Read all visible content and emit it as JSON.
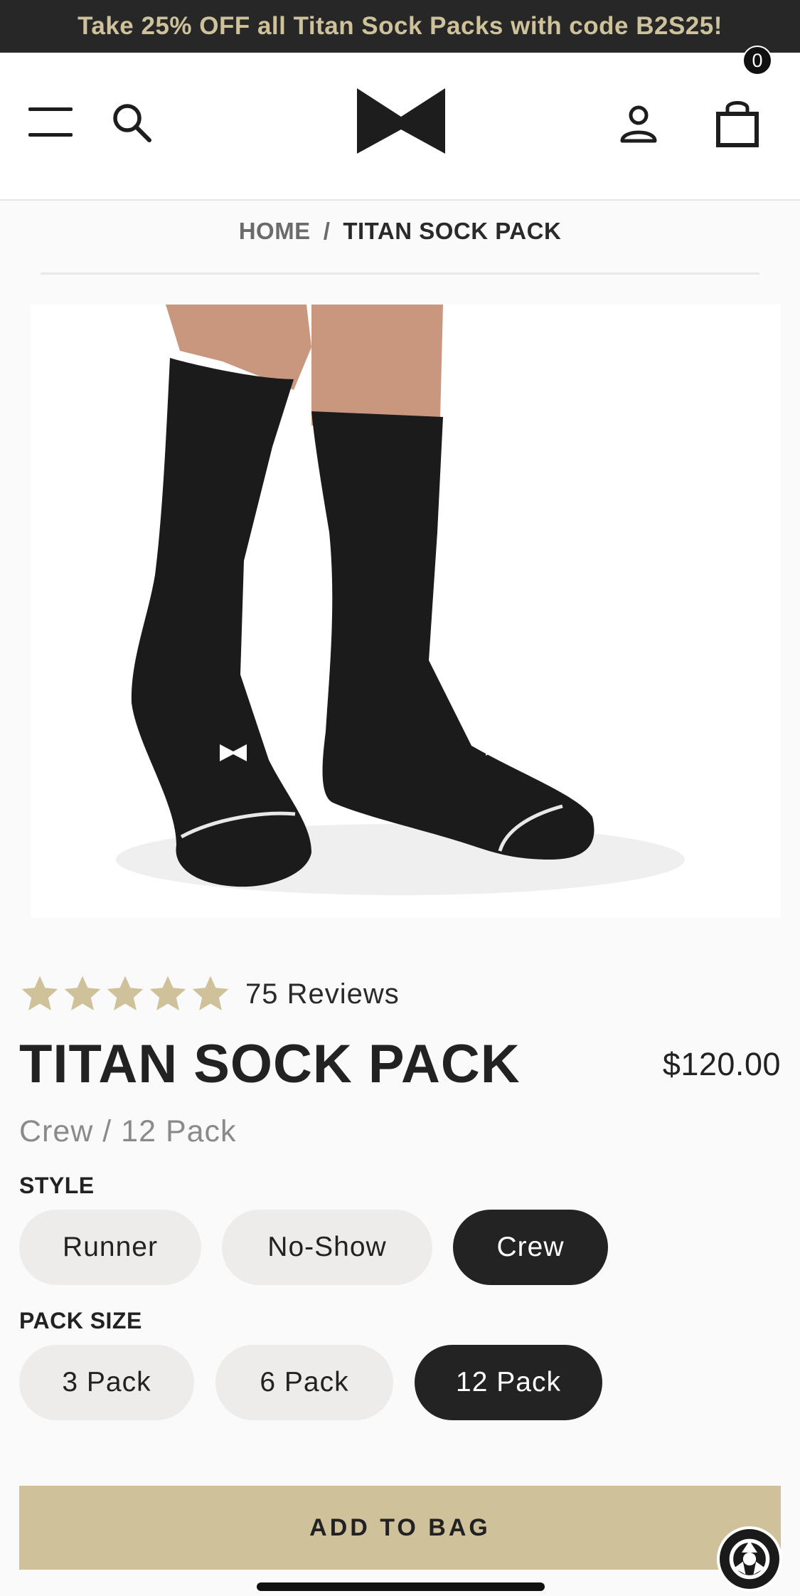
{
  "promo_banner": {
    "text": "Take 25% OFF all Titan Sock Packs with code B2S25!"
  },
  "header": {
    "menu_icon": "hamburger-menu-icon",
    "search_icon": "search-icon",
    "logo_icon": "brand-bowtie-logo",
    "account_icon": "user-icon",
    "bag_icon": "shopping-bag-icon",
    "bag_count": "0"
  },
  "breadcrumb": {
    "home": "HOME",
    "separator": "/",
    "current": "TITAN SOCK PACK"
  },
  "product": {
    "image_alt": "black crew socks worn on feet",
    "rating": 5,
    "reviews_label": "75 Reviews",
    "title": "TITAN SOCK PACK",
    "price": "$120.00",
    "selected_variant": "Crew / 12 Pack"
  },
  "options": {
    "style": {
      "label": "STYLE",
      "values": [
        "Runner",
        "No-Show",
        "Crew"
      ],
      "selected": "Crew"
    },
    "pack_size": {
      "label": "PACK SIZE",
      "values": [
        "3 Pack",
        "6 Pack",
        "12 Pack"
      ],
      "selected": "12 Pack"
    }
  },
  "cta": {
    "add_to_bag": "ADD TO BAG"
  },
  "colors": {
    "accent_gold": "#cfc29a",
    "dark": "#232323",
    "pill_bg": "#eeeceb"
  }
}
